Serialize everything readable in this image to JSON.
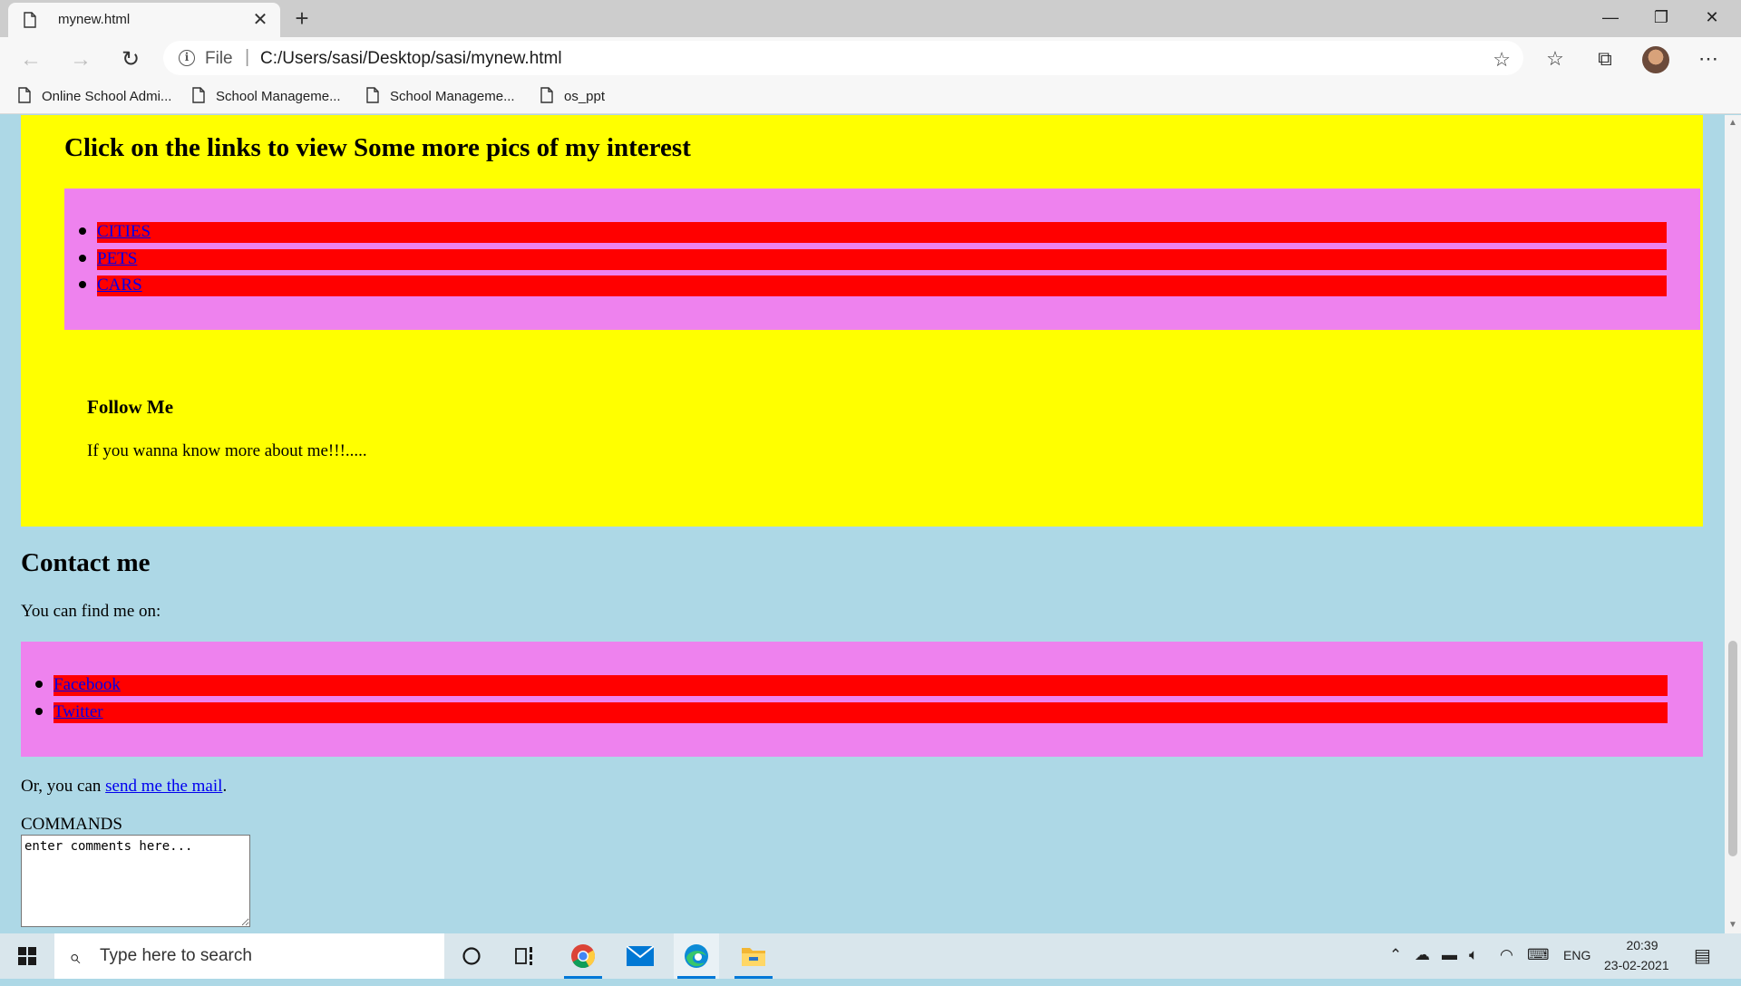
{
  "browser": {
    "tab_title": "mynew.html",
    "tab_close": "✕",
    "new_tab": "+",
    "window_minimize": "—",
    "window_restore": "❐",
    "window_close": "✕",
    "back": "←",
    "forward": "→",
    "reload": "↻",
    "info_icon": "i",
    "url_scheme": "File",
    "url_separator": "|",
    "url": "C:/Users/sasi/Desktop/sasi/mynew.html",
    "bookmarks": [
      {
        "label": "Online School Admi..."
      },
      {
        "label": "School Manageme..."
      },
      {
        "label": "School Manageme..."
      },
      {
        "label": "os_ppt"
      }
    ],
    "toolbar_icons": [
      "favorites-add-icon",
      "favorites-icon",
      "collections-icon",
      "profile-avatar",
      "more-icon"
    ]
  },
  "page": {
    "interest_heading": "Click on the links to view Some more pics of my interest",
    "interest_links": [
      {
        "label": "CITIES"
      },
      {
        "label": "PETS"
      },
      {
        "label": "CARS"
      }
    ],
    "follow_heading": "Follow Me",
    "follow_text": "If you wanna know more about me!!!.....",
    "contact_heading": "Contact me",
    "contact_text": "You can find me on:",
    "social_links": [
      {
        "label": "Facebook"
      },
      {
        "label": "Twitter"
      }
    ],
    "mail_prefix": "Or, you can ",
    "mail_link": "send me the mail",
    "mail_suffix": ".",
    "commands_label": "COMMANDS",
    "comments_placeholder": "enter comments here...",
    "colors": {
      "background": "#add8e6",
      "section": "#ffff00",
      "list_box": "#ee82ee",
      "list_item": "#ff0000",
      "link": "#0000ee"
    }
  },
  "taskbar": {
    "search_placeholder": "Type here to search",
    "language": "ENG",
    "time": "20:39",
    "date": "23-02-2021",
    "apps": [
      "cortana-icon",
      "task-view-icon",
      "chrome-icon",
      "mail-icon",
      "edge-icon",
      "file-explorer-icon"
    ]
  }
}
